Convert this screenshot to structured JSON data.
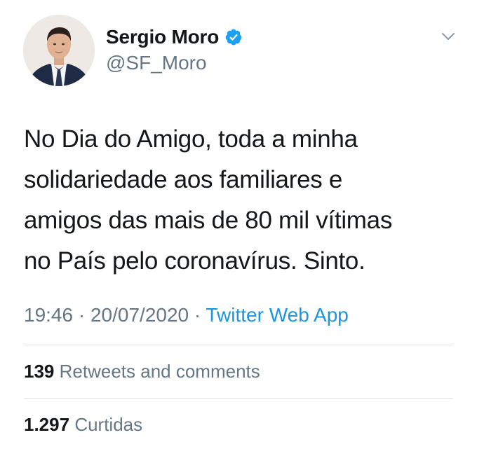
{
  "user": {
    "display_name": "Sergio Moro",
    "handle": "@SF_Moro",
    "verified": true
  },
  "tweet": {
    "lines": [
      "No Dia do Amigo, toda a minha",
      "solidariedade aos familiares e",
      "amigos das mais de 80 mil vítimas",
      "no País pelo coronavírus. Sinto."
    ],
    "time": "19:46",
    "date": "20/07/2020",
    "separator": "·",
    "source": "Twitter Web App"
  },
  "stats": {
    "retweets_count": "139",
    "retweets_label": "Retweets and comments",
    "likes_count": "1.297",
    "likes_label": "Curtidas"
  },
  "colors": {
    "text": "#14171a",
    "secondary": "#657786",
    "link": "#1b95e0",
    "verified": "#1da1f2",
    "divider": "#dfe4e8"
  },
  "icons": {
    "verified": "verified-badge-icon",
    "menu": "chevron-down-icon"
  }
}
